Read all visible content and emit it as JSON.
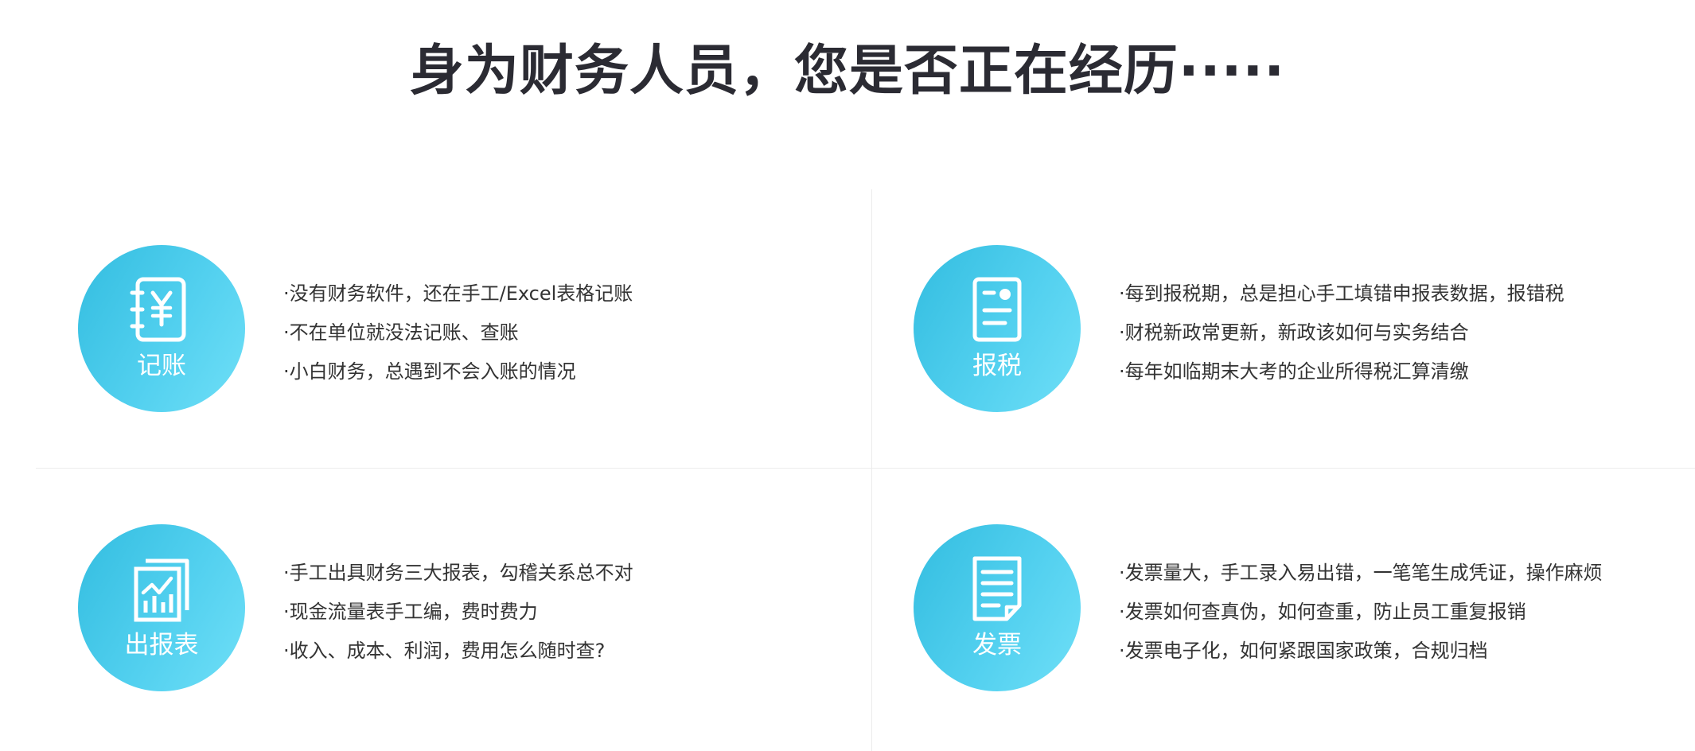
{
  "page": {
    "title": "身为财务人员，您是否正在经历·····"
  },
  "colors": {
    "badge_gradient_start": "#33bde0",
    "badge_gradient_end": "#6fdff7",
    "title_color": "#2b2b33",
    "text_color": "#333333",
    "divider_color": "#ececec"
  },
  "cards": [
    {
      "label": "记账",
      "icon": "ledger-yen-icon",
      "items": [
        "·没有财务软件，还在手工/Excel表格记账",
        "·不在单位就没法记账、查账",
        "·小白财务，总遇到不会入账的情况"
      ]
    },
    {
      "label": "报税",
      "icon": "tax-document-icon",
      "items": [
        "·每到报税期，总是担心手工填错申报表数据，报错税",
        "·财税新政常更新，新政该如何与实务结合",
        "·每年如临期末大考的企业所得税汇算清缴"
      ]
    },
    {
      "label": "出报表",
      "icon": "report-chart-icon",
      "items": [
        "·手工出具财务三大报表，勾稽关系总不对",
        "·现金流量表手工编，费时费力",
        "·收入、成本、利润，费用怎么随时查?"
      ]
    },
    {
      "label": "发票",
      "icon": "invoice-document-icon",
      "items": [
        "·发票量大，手工录入易出错，一笔笔生成凭证，操作麻烦",
        "·发票如何查真伪，如何查重，防止员工重复报销",
        "·发票电子化，如何紧跟国家政策，合规归档"
      ]
    }
  ]
}
